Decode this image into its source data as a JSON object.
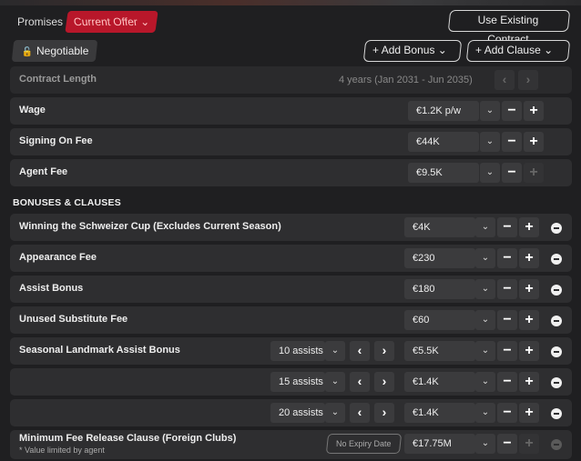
{
  "tabs": {
    "promises": "Promises",
    "current_offer": "Current Offer",
    "current_offer_chevron": "⌄"
  },
  "buttons": {
    "use_existing": "Use Existing Contract",
    "negotiable": "Negotiable",
    "add_bonus": "Add Bonus",
    "add_clause": "Add Clause"
  },
  "contract": {
    "length_label": "Contract Length",
    "length_value": "4 years (Jan 2031 - Jun 2035)",
    "wage_label": "Wage",
    "wage_value": "€1.2K p/w",
    "signing_label": "Signing On Fee",
    "signing_value": "€44K",
    "agent_label": "Agent Fee",
    "agent_value": "€9.5K"
  },
  "bonuses": {
    "title": "BONUSES & CLAUSES",
    "cup_label": "Winning the Schweizer Cup (Excludes Current Season)",
    "cup_value": "€4K",
    "appearance_label": "Appearance Fee",
    "appearance_value": "€230",
    "assist_label": "Assist Bonus",
    "assist_value": "€180",
    "unused_label": "Unused Substitute Fee",
    "unused_value": "€60",
    "landmark_label": "Seasonal Landmark Assist Bonus",
    "landmarks": [
      {
        "assists": "10 assists",
        "value": "€5.5K"
      },
      {
        "assists": "15 assists",
        "value": "€1.4K"
      },
      {
        "assists": "20 assists",
        "value": "€1.4K"
      }
    ],
    "release_label": "Minimum Fee Release Clause (Foreign Clubs)",
    "release_note": "* Value limited by agent",
    "release_expiry": "No Expiry Date",
    "release_value": "€17.75M"
  },
  "glyphs": {
    "plus": "+",
    "minus": "−",
    "chevron": "⌄",
    "left": "‹",
    "right": "›",
    "lock": "🔓"
  }
}
